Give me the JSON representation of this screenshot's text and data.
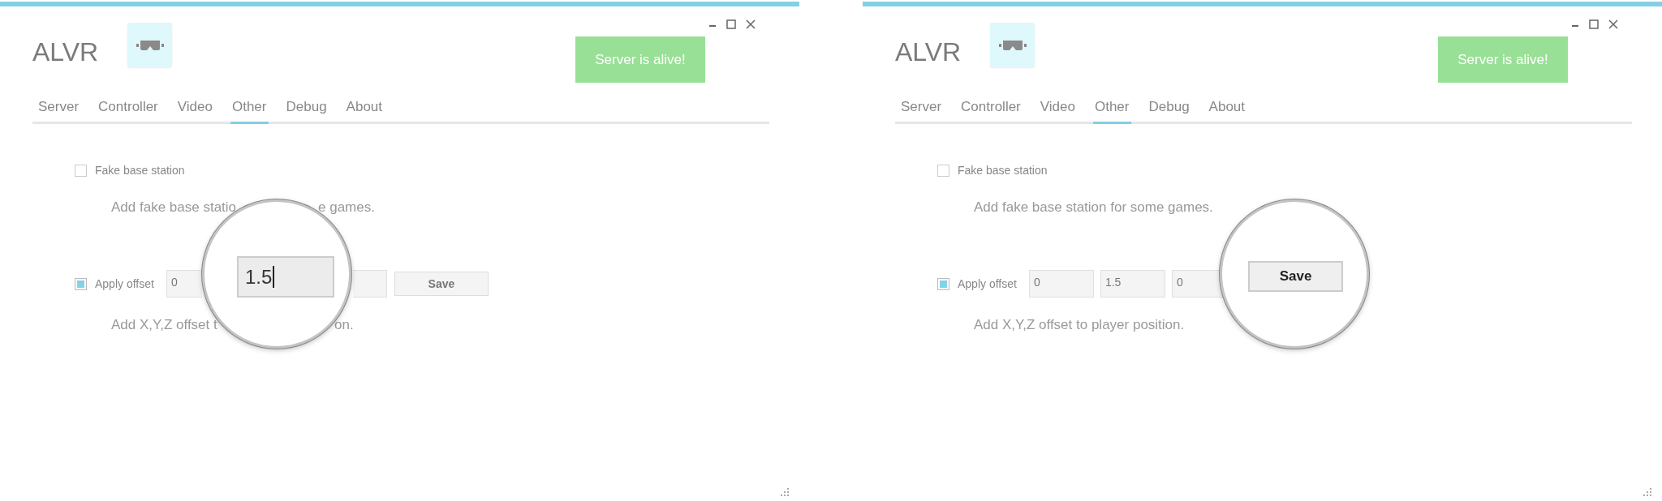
{
  "windows": [
    {
      "title": "ALVR",
      "status": "Server is alive!",
      "tabs": [
        {
          "label": "Server",
          "selected": false
        },
        {
          "label": "Controller",
          "selected": false
        },
        {
          "label": "Video",
          "selected": false
        },
        {
          "label": "Other",
          "selected": true
        },
        {
          "label": "Debug",
          "selected": false
        },
        {
          "label": "About",
          "selected": false
        }
      ],
      "fake_base_station": {
        "label": "Fake base station",
        "checked": false,
        "description": [
          "Add fake base statio",
          "e games."
        ]
      },
      "apply_offset": {
        "label": "Apply offset",
        "checked": true,
        "fields": [
          {
            "value": "0",
            "magnified": false
          },
          {
            "value": "1.5",
            "magnified": true
          },
          {
            "magnified": false
          }
        ],
        "save": {
          "label": "Save",
          "magnified": false
        },
        "description": [
          "Add X,Y,Z offset t",
          "on."
        ]
      }
    },
    {
      "title": "ALVR",
      "status": "Server is alive!",
      "tabs": [
        {
          "label": "Server",
          "selected": false
        },
        {
          "label": "Controller",
          "selected": false
        },
        {
          "label": "Video",
          "selected": false
        },
        {
          "label": "Other",
          "selected": true
        },
        {
          "label": "Debug",
          "selected": false
        },
        {
          "label": "About",
          "selected": false
        }
      ],
      "fake_base_station": {
        "label": "Fake base station",
        "checked": false,
        "description": [
          "Add fake base station for some games."
        ]
      },
      "apply_offset": {
        "label": "Apply offset",
        "checked": true,
        "fields": [
          {
            "value": "0",
            "magnified": false
          },
          {
            "value": "1.5",
            "magnified": false
          },
          {
            "value": "0",
            "magnified": false
          }
        ],
        "save": {
          "label": "Save",
          "magnified": true
        },
        "description": [
          "Add X,Y,Z offset to player position."
        ]
      }
    }
  ]
}
